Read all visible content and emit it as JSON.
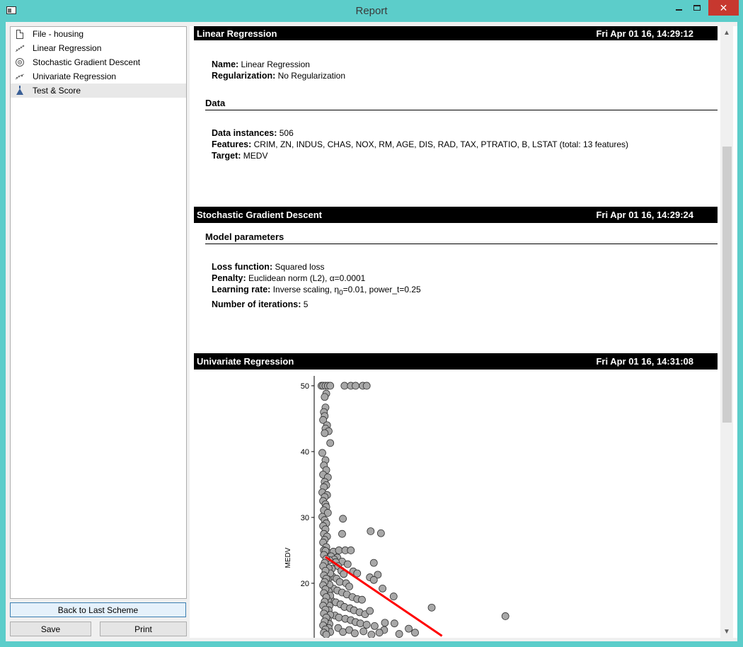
{
  "window": {
    "title": "Report",
    "close_glyph": "✕"
  },
  "sidebar": {
    "items": [
      {
        "label": "File - housing",
        "icon": "file-icon"
      },
      {
        "label": "Linear Regression",
        "icon": "linear-regression-icon"
      },
      {
        "label": "Stochastic Gradient Descent",
        "icon": "sgd-icon"
      },
      {
        "label": "Univariate Regression",
        "icon": "univariate-regression-icon"
      },
      {
        "label": "Test & Score",
        "icon": "flask-icon",
        "selected": true
      }
    ],
    "back_label": "Back to Last Scheme",
    "save_label": "Save",
    "print_label": "Print"
  },
  "report": {
    "linear": {
      "title": "Linear Regression",
      "timestamp": "Fri Apr 01 16, 14:29:12",
      "name_label": "Name:",
      "name_value": " Linear Regression",
      "reg_label": "Regularization:",
      "reg_value": " No Regularization",
      "data_heading": "Data",
      "instances_label": "Data instances:",
      "instances_value": " 506",
      "features_label": "Features:",
      "features_value": " CRIM, ZN, INDUS, CHAS, NOX, RM, AGE, DIS, RAD, TAX, PTRATIO, B, LSTAT (total: 13 features)",
      "target_label": "Target:",
      "target_value": " MEDV"
    },
    "sgd": {
      "title": "Stochastic Gradient Descent",
      "timestamp": "Fri Apr 01 16, 14:29:24",
      "params_heading": "Model parameters",
      "loss_label": "Loss function:",
      "loss_value": " Squared loss",
      "penalty_label": "Penalty:",
      "penalty_value": " Euclidean norm (L2), α=0.0001",
      "lr_label": "Learning rate:",
      "lr_value_pre": " Inverse scaling, η",
      "lr_sub": "0",
      "lr_value_post": "=0.01, power_t=0.25",
      "iter_label": "Number of iterations:",
      "iter_value": " 5"
    },
    "univariate": {
      "title": "Univariate Regression",
      "timestamp": "Fri Apr 01 16, 14:31:08"
    }
  },
  "chart_data": {
    "type": "scatter",
    "ylabel": "MEDV",
    "xlabel": "",
    "y_ticks": [
      20,
      30,
      40,
      50
    ],
    "ylim": [
      12,
      51.5
    ],
    "xlim": [
      0,
      40
    ],
    "point_color": "#a8a8a8",
    "line_color": "#ff0000",
    "points": [
      [
        0.3,
        50
      ],
      [
        0.5,
        50
      ],
      [
        0.8,
        50
      ],
      [
        1.1,
        50
      ],
      [
        1.4,
        50
      ],
      [
        3.2,
        50
      ],
      [
        4.0,
        50
      ],
      [
        4.6,
        50
      ],
      [
        5.5,
        50
      ],
      [
        6.0,
        50
      ],
      [
        0.9,
        48.8
      ],
      [
        0.7,
        48.3
      ],
      [
        0.8,
        46.7
      ],
      [
        0.6,
        46
      ],
      [
        0.7,
        45.4
      ],
      [
        0.5,
        44.8
      ],
      [
        1.0,
        44
      ],
      [
        0.8,
        43.5
      ],
      [
        1.2,
        43.1
      ],
      [
        0.7,
        42.8
      ],
      [
        1.4,
        41.3
      ],
      [
        0.4,
        39.8
      ],
      [
        0.8,
        38.7
      ],
      [
        0.6,
        37.9
      ],
      [
        0.9,
        37.2
      ],
      [
        0.5,
        36.5
      ],
      [
        1.1,
        36.1
      ],
      [
        0.7,
        35.4
      ],
      [
        0.9,
        34.9
      ],
      [
        0.6,
        34.6
      ],
      [
        0.4,
        33.8
      ],
      [
        1.0,
        33.4
      ],
      [
        0.7,
        33.1
      ],
      [
        0.5,
        32.5
      ],
      [
        0.8,
        32
      ],
      [
        0.9,
        31.6
      ],
      [
        0.6,
        31.1
      ],
      [
        1.1,
        30.7
      ],
      [
        0.4,
        30.1
      ],
      [
        0.7,
        29.6
      ],
      [
        0.9,
        29.1
      ],
      [
        0.5,
        28.7
      ],
      [
        0.8,
        28.2
      ],
      [
        0.6,
        27.5
      ],
      [
        1.0,
        27.1
      ],
      [
        0.7,
        26.6
      ],
      [
        0.5,
        26.2
      ],
      [
        0.9,
        25.5
      ],
      [
        0.6,
        25
      ],
      [
        1.2,
        24.6
      ],
      [
        3.0,
        29.8
      ],
      [
        2.9,
        27.5
      ],
      [
        6.5,
        27.9
      ],
      [
        7.8,
        27.6
      ],
      [
        6.9,
        23.1
      ],
      [
        1.8,
        24.8
      ],
      [
        2.5,
        25
      ],
      [
        3.3,
        25
      ],
      [
        4.0,
        25
      ],
      [
        2.3,
        23.9
      ],
      [
        2.9,
        23.3
      ],
      [
        3.6,
        22.9
      ],
      [
        4.3,
        21.8
      ],
      [
        4.8,
        21.5
      ],
      [
        6.4,
        20.9
      ],
      [
        7.4,
        21.3
      ],
      [
        6.9,
        20.5
      ],
      [
        8.0,
        19.2
      ],
      [
        9.4,
        18
      ],
      [
        14.2,
        16.3
      ],
      [
        23.5,
        15
      ],
      [
        1.5,
        24.1
      ],
      [
        1.9,
        23.6
      ],
      [
        2.1,
        23.2
      ],
      [
        2.4,
        22.6
      ],
      [
        1.6,
        22.2
      ],
      [
        2.8,
        21.9
      ],
      [
        3.1,
        21.4
      ],
      [
        1.7,
        21
      ],
      [
        2.2,
        20.7
      ],
      [
        2.6,
        20.2
      ],
      [
        3.4,
        20
      ],
      [
        3.8,
        19.5
      ],
      [
        1.8,
        19.2
      ],
      [
        2.3,
        18.9
      ],
      [
        2.9,
        18.6
      ],
      [
        3.5,
        18.3
      ],
      [
        4.2,
        17.9
      ],
      [
        4.8,
        17.6
      ],
      [
        5.4,
        17.5
      ],
      [
        1.6,
        17.3
      ],
      [
        2.1,
        17.1
      ],
      [
        2.7,
        16.8
      ],
      [
        3.2,
        16.4
      ],
      [
        3.9,
        16.2
      ],
      [
        4.4,
        15.9
      ],
      [
        5.1,
        15.6
      ],
      [
        5.8,
        15.3
      ],
      [
        6.4,
        15.8
      ],
      [
        2.0,
        15.1
      ],
      [
        2.5,
        14.8
      ],
      [
        3.3,
        14.6
      ],
      [
        4.0,
        14.4
      ],
      [
        4.6,
        14.1
      ],
      [
        5.2,
        13.9
      ],
      [
        6.0,
        13.7
      ],
      [
        7.0,
        13.5
      ],
      [
        8.3,
        14
      ],
      [
        9.5,
        13.9
      ],
      [
        11.3,
        13.1
      ],
      [
        8.2,
        12.9
      ],
      [
        10.1,
        12.3
      ],
      [
        12.1,
        12.5
      ],
      [
        1.3,
        23.5
      ],
      [
        1.2,
        22.3
      ],
      [
        1.4,
        21.5
      ],
      [
        1.1,
        20.6
      ],
      [
        1.3,
        19.8
      ],
      [
        1.2,
        18.8
      ],
      [
        1.4,
        18.1
      ],
      [
        1.1,
        17.4
      ],
      [
        1.3,
        16.6
      ],
      [
        1.2,
        15.9
      ],
      [
        1.4,
        15.2
      ],
      [
        1.1,
        14.5
      ],
      [
        1.3,
        13.8
      ],
      [
        1.2,
        13.2
      ],
      [
        1.4,
        12.6
      ],
      [
        0.8,
        24.9
      ],
      [
        0.6,
        24.3
      ],
      [
        0.9,
        23.7
      ],
      [
        0.7,
        23.1
      ],
      [
        0.5,
        22.6
      ],
      [
        0.8,
        21.9
      ],
      [
        0.6,
        21.2
      ],
      [
        0.9,
        20.7
      ],
      [
        0.7,
        20.2
      ],
      [
        0.5,
        19.7
      ],
      [
        0.8,
        19.1
      ],
      [
        0.6,
        18.5
      ],
      [
        0.9,
        17.9
      ],
      [
        0.7,
        17.2
      ],
      [
        0.5,
        16.6
      ],
      [
        0.8,
        16
      ],
      [
        0.6,
        15.4
      ],
      [
        0.9,
        14.8
      ],
      [
        0.7,
        14.2
      ],
      [
        0.5,
        13.6
      ],
      [
        0.8,
        13
      ],
      [
        0.6,
        12.5
      ],
      [
        0.9,
        12.2
      ],
      [
        2.4,
        13.2
      ],
      [
        3.0,
        12.6
      ],
      [
        3.8,
        12.9
      ],
      [
        4.5,
        12.4
      ],
      [
        5.6,
        12.7
      ],
      [
        6.6,
        12.2
      ],
      [
        7.6,
        12.5
      ]
    ],
    "regression_line": [
      [
        0.8,
        24
      ],
      [
        15.5,
        12
      ]
    ]
  }
}
